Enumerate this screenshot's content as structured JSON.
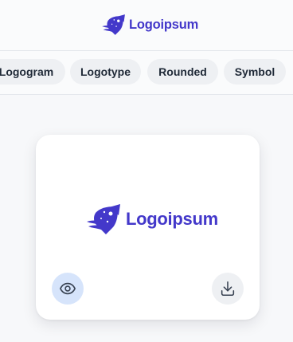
{
  "brand": {
    "name": "Logoipsum",
    "color": "#4338ca",
    "accent": "#4f46e5",
    "icon": "rocket-logo-icon"
  },
  "tabs": [
    {
      "label": "Logogram"
    },
    {
      "label": "Logotype"
    },
    {
      "label": "Rounded"
    },
    {
      "label": "Symbol"
    }
  ],
  "card": {
    "logo_text": "Logoipsum",
    "actions": {
      "preview_icon": "eye-icon",
      "download_icon": "download-icon"
    }
  },
  "colors": {
    "background": "#f7f8fa",
    "tab_bg": "#eef0f3",
    "preview_bg": "#d6e4fb"
  }
}
